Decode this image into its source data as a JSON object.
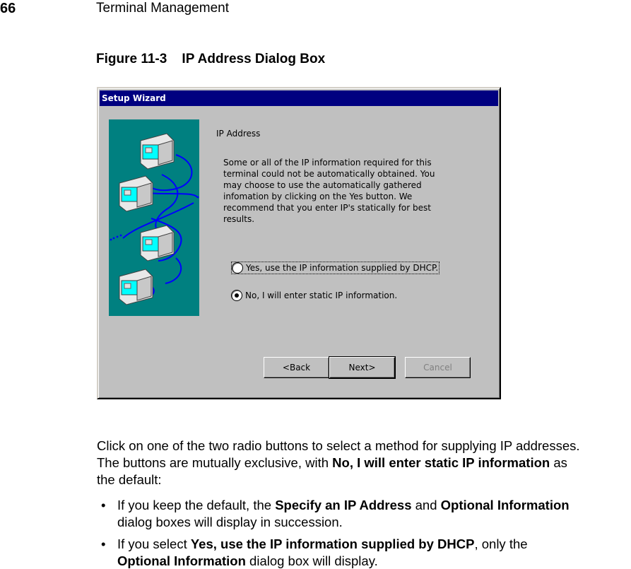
{
  "header": {
    "page_number": "66",
    "running_head": "Terminal Management"
  },
  "figure": {
    "caption": "Figure 11-3    IP Address Dialog Box"
  },
  "dialog": {
    "title": "Setup Wizard",
    "heading": "IP Address",
    "body_lines": [
      "Some or all of the IP information required for this",
      "terminal could not be automatically obtained. You",
      "may choose to use the automatically gathered",
      "infomation by clicking on the Yes button.  We",
      "recommend that you enter IP's statically for best",
      "results."
    ],
    "radio_yes": {
      "label": "Yes, use the IP information supplied by DHCP.",
      "checked": false
    },
    "radio_no": {
      "label": "No, I will enter static IP information.",
      "checked": true
    },
    "buttons": {
      "back": "<Back",
      "next": "Next>",
      "cancel": "Cancel"
    },
    "colors": {
      "title_bar": "#000080",
      "face": "#c0c0c0",
      "graphic_bg": "#008080"
    },
    "graphic_icons": [
      "computer-icon",
      "computer-icon",
      "computer-icon",
      "computer-icon"
    ]
  },
  "text": {
    "para_1": "Click on one of the two radio buttons to select a method for supplying IP addresses.",
    "para_2a": "The buttons are mutually exclusive, with ",
    "para_2b": "No, I will enter static IP information",
    "para_2c": " as",
    "para_3": "the default:",
    "bullet_char": "•",
    "bullet1_a": "If you keep the default, the ",
    "bullet1_b": "Specify an IP Address",
    "bullet1_c": " and ",
    "bullet1_d": "Optional Information",
    "bullet1_e": "dialog boxes will display in succession.",
    "bullet2_a": "If you select ",
    "bullet2_b": "Yes, use the IP information supplied by DHCP",
    "bullet2_c": ", only the",
    "bullet2_d": "Optional Information",
    "bullet2_e": " dialog box will display."
  }
}
